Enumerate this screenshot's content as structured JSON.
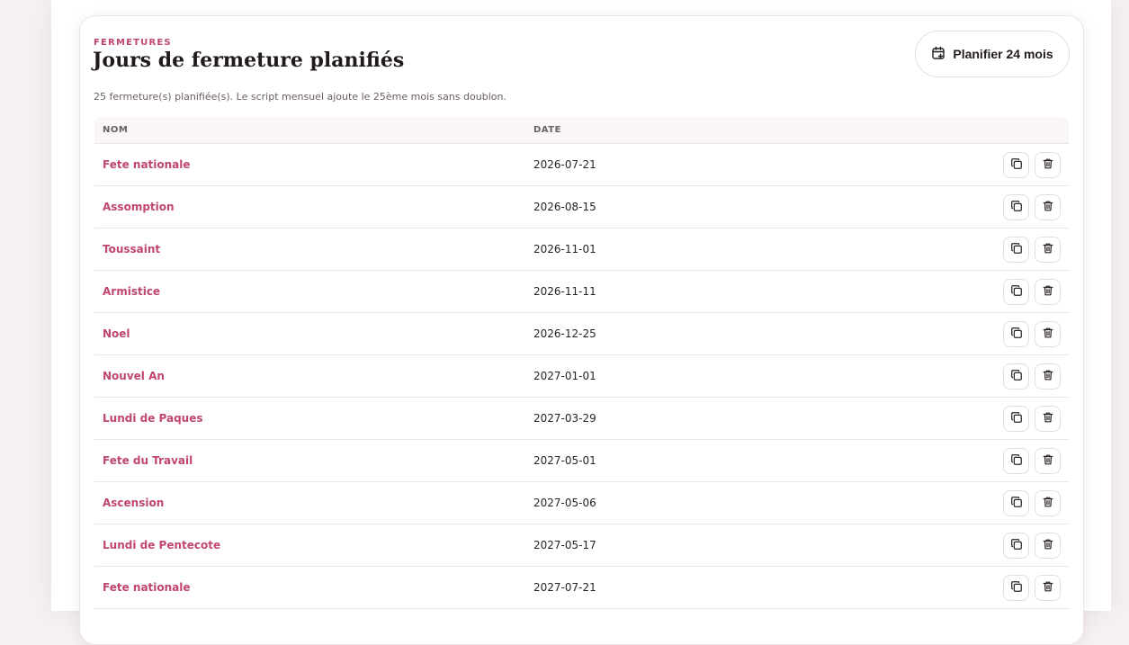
{
  "header": {
    "eyebrow": "FERMETURES",
    "title": "Jours de fermeture planifiés",
    "subtitle": "25 fermeture(s) planifiée(s). Le script mensuel ajoute le 25ème mois sans doublon.",
    "plan_button": "Planifier 24 mois",
    "plan_icon": "calendar-plus-icon"
  },
  "table": {
    "columns": [
      "NOM",
      "DATE"
    ],
    "rows": [
      {
        "name": "Fete nationale",
        "date": "2026-07-21"
      },
      {
        "name": "Assomption",
        "date": "2026-08-15"
      },
      {
        "name": "Toussaint",
        "date": "2026-11-01"
      },
      {
        "name": "Armistice",
        "date": "2026-11-11"
      },
      {
        "name": "Noel",
        "date": "2026-12-25"
      },
      {
        "name": "Nouvel An",
        "date": "2027-01-01"
      },
      {
        "name": "Lundi de Paques",
        "date": "2027-03-29"
      },
      {
        "name": "Fete du Travail",
        "date": "2027-05-01"
      },
      {
        "name": "Ascension",
        "date": "2027-05-06"
      },
      {
        "name": "Lundi de Pentecote",
        "date": "2027-05-17"
      },
      {
        "name": "Fete nationale",
        "date": "2027-07-21"
      }
    ],
    "row_actions": [
      "copy-icon",
      "trash-icon"
    ]
  },
  "colors": {
    "accent": "#c0466e",
    "text": "#211a1d",
    "muted": "#6a5f63",
    "border": "#ece4e6"
  }
}
